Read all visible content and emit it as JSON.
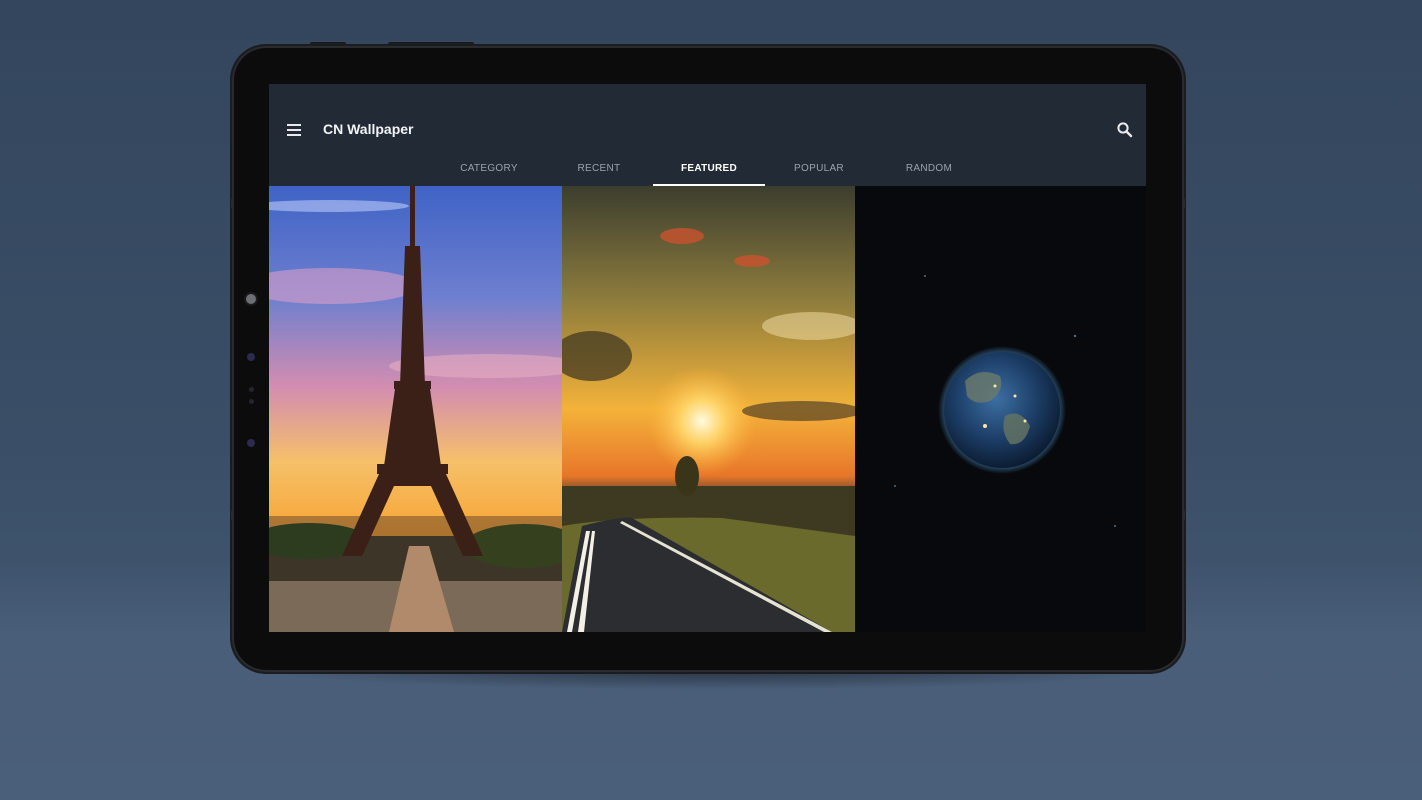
{
  "app": {
    "title": "CN Wallpaper",
    "menu_icon": "hamburger-menu-icon",
    "search_icon": "search-icon"
  },
  "tabs": [
    {
      "label": "CATEGORY",
      "active": false
    },
    {
      "label": "RECENT",
      "active": false
    },
    {
      "label": "FEATURED",
      "active": true
    },
    {
      "label": "POPULAR",
      "active": false
    },
    {
      "label": "RANDOM",
      "active": false
    }
  ],
  "wallpapers": [
    {
      "subject": "eiffel-tower-sunset"
    },
    {
      "subject": "road-sunset"
    },
    {
      "subject": "earth-in-space"
    }
  ],
  "colors": {
    "background": "#33465d",
    "appbar": "#222b35",
    "tab_active": "#ffffff",
    "tab_inactive": "#9aa3ad"
  }
}
